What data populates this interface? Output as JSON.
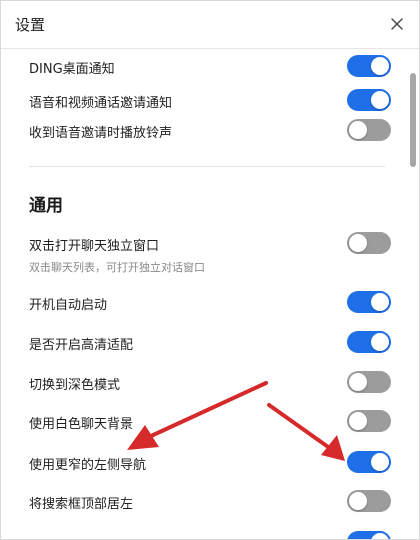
{
  "window": {
    "title": "设置",
    "close_icon": "close-icon"
  },
  "colors": {
    "toggle_on": "#1e6fe8",
    "toggle_off": "#9c9c9c",
    "annotation_arrow": "#d62a2a"
  },
  "notifications": {
    "items": [
      {
        "label": "DING桌面通知",
        "enabled": true
      },
      {
        "label": "语音和视频通话邀请通知",
        "enabled": true
      },
      {
        "label": "收到语音邀请时播放铃声",
        "enabled": false
      }
    ]
  },
  "general": {
    "heading": "通用",
    "items": [
      {
        "label": "双击打开聊天独立窗口",
        "sublabel": "双击聊天列表，可打开独立对话窗口",
        "enabled": false
      },
      {
        "label": "开机自动启动",
        "enabled": true
      },
      {
        "label": "是否开启高清适配",
        "enabled": true
      },
      {
        "label": "切换到深色模式",
        "enabled": false
      },
      {
        "label": "使用白色聊天背景",
        "enabled": false
      },
      {
        "label": "使用更窄的左侧导航",
        "enabled": true
      },
      {
        "label": "将搜索框顶部居左",
        "enabled": false
      },
      {
        "label": "",
        "enabled": true
      }
    ]
  }
}
